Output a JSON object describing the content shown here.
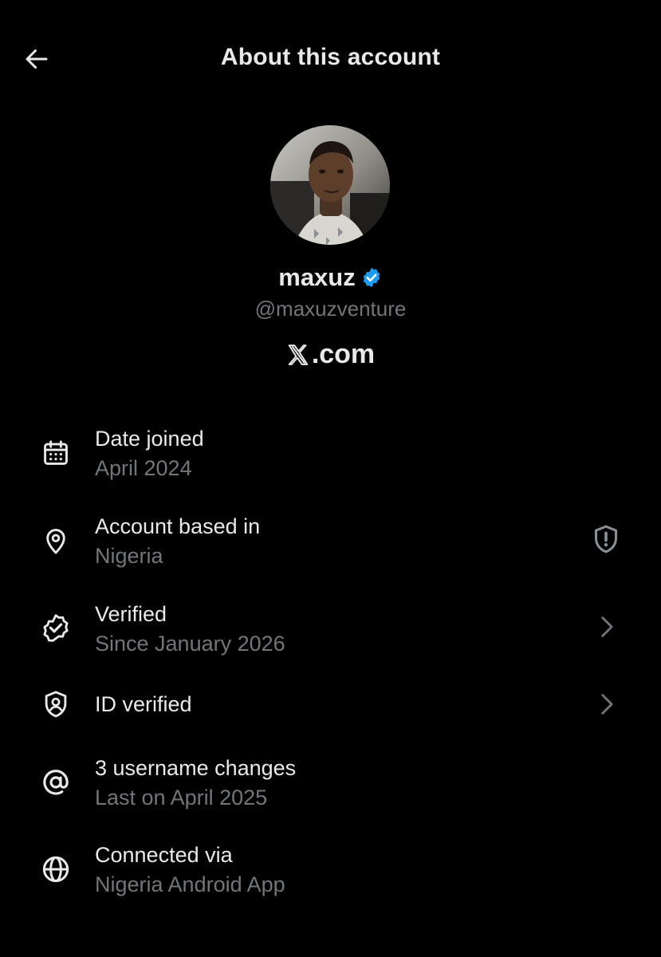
{
  "header": {
    "title": "About this account",
    "back_icon": "arrow-left-icon"
  },
  "profile": {
    "display_name": "maxuz",
    "handle": "@maxuzventure",
    "verified_badge_color": "#1d9bf0",
    "verified_badge_icon": "verified-badge-icon",
    "site_logo_text": "X",
    "site_suffix": ".com"
  },
  "rows": [
    {
      "icon": "calendar-icon",
      "title": "Date joined",
      "subtitle": "April 2024",
      "trailing": ""
    },
    {
      "icon": "location-pin-icon",
      "title": "Account based in",
      "subtitle": "Nigeria",
      "trailing": "shield-alert-icon"
    },
    {
      "icon": "verified-check-icon",
      "title": "Verified",
      "subtitle": "Since January 2026",
      "trailing": "chevron-right-icon"
    },
    {
      "icon": "id-shield-icon",
      "title": "ID verified",
      "subtitle": "",
      "trailing": "chevron-right-icon"
    },
    {
      "icon": "at-sign-icon",
      "title": "3 username changes",
      "subtitle": "Last on April 2025",
      "trailing": ""
    },
    {
      "icon": "globe-icon",
      "title": "Connected via",
      "subtitle": "Nigeria Android App",
      "trailing": ""
    }
  ],
  "colors": {
    "background": "#000000",
    "primary_text": "#e7e9ea",
    "secondary_text": "#71767b",
    "accent": "#1d9bf0"
  }
}
